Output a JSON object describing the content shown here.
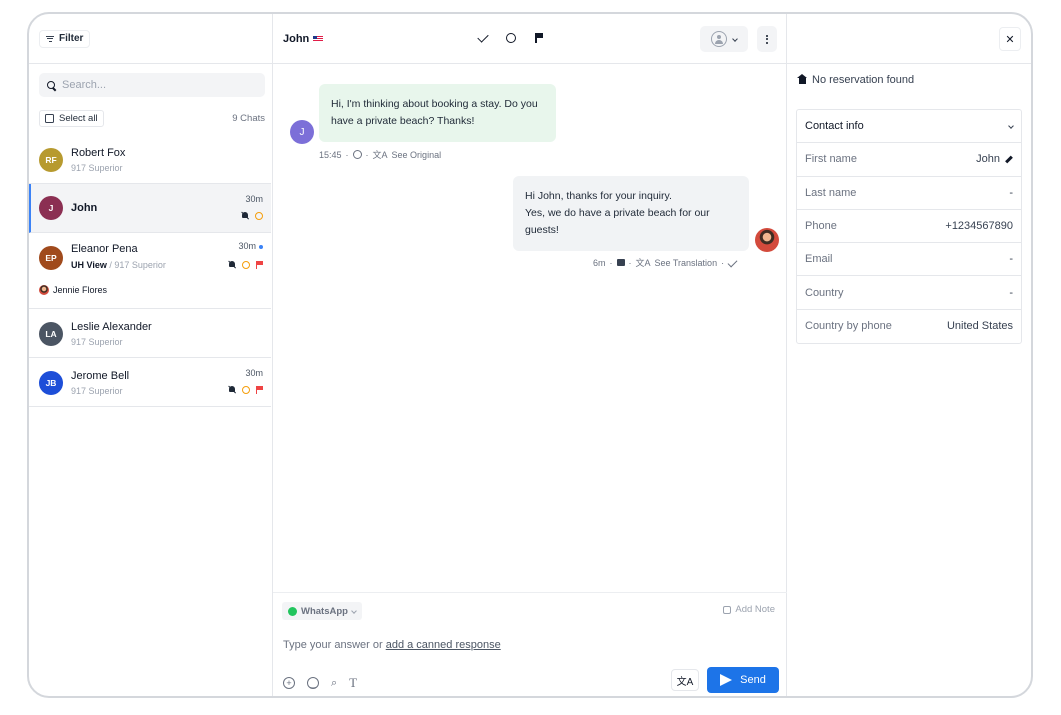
{
  "left": {
    "filter_label": "Filter",
    "search_placeholder": "Search...",
    "select_all": "Select all",
    "chats_count": "9 Chats",
    "chats": [
      {
        "initials": "RF",
        "name": "Robert Fox",
        "sub": "917 Superior",
        "time": "",
        "color": "#b79a2f"
      },
      {
        "initials": "J",
        "name": "John",
        "sub": "",
        "time": "30m",
        "color": "#8b2f52"
      },
      {
        "initials": "EP",
        "name": "Eleanor Pena",
        "sub_bold": "UH View",
        "sub": "/ 917 Superior",
        "time": "30m",
        "agent": "Jennie Flores",
        "color": "#a04a1c"
      },
      {
        "initials": "LA",
        "name": "Leslie Alexander",
        "sub": "917 Superior",
        "time": "",
        "color": "#4b5563"
      },
      {
        "initials": "JB",
        "name": "Jerome Bell",
        "sub": "917 Superior",
        "time": "30m",
        "color": "#1d4ed8"
      }
    ]
  },
  "center": {
    "contact_name": "John",
    "messages": [
      {
        "direction": "in",
        "initial": "J",
        "text": "Hi, I'm thinking about booking a stay. Do you have a private beach? Thanks!",
        "time": "15:45",
        "link": "See Original"
      },
      {
        "direction": "out",
        "text_lines": [
          "Hi John, thanks for your inquiry.",
          "Yes, we do have a private beach for our guests!"
        ],
        "time": "6m",
        "link": "See Translation"
      }
    ],
    "composer": {
      "channel": "WhatsApp",
      "add_note": "Add Note",
      "placeholder_prefix": "Type your answer or",
      "placeholder_link": "add a canned response",
      "translate_label": "文A",
      "send_label": "Send"
    }
  },
  "right": {
    "no_reservation": "No reservation found",
    "section_title": "Contact info",
    "fields": [
      {
        "label": "First name",
        "value": "John"
      },
      {
        "label": "Last name",
        "value": "-"
      },
      {
        "label": "Phone",
        "value": "+1234567890"
      },
      {
        "label": "Email",
        "value": "-"
      },
      {
        "label": "Country",
        "value": "-"
      },
      {
        "label": "Country by phone",
        "value": "United States"
      }
    ]
  }
}
